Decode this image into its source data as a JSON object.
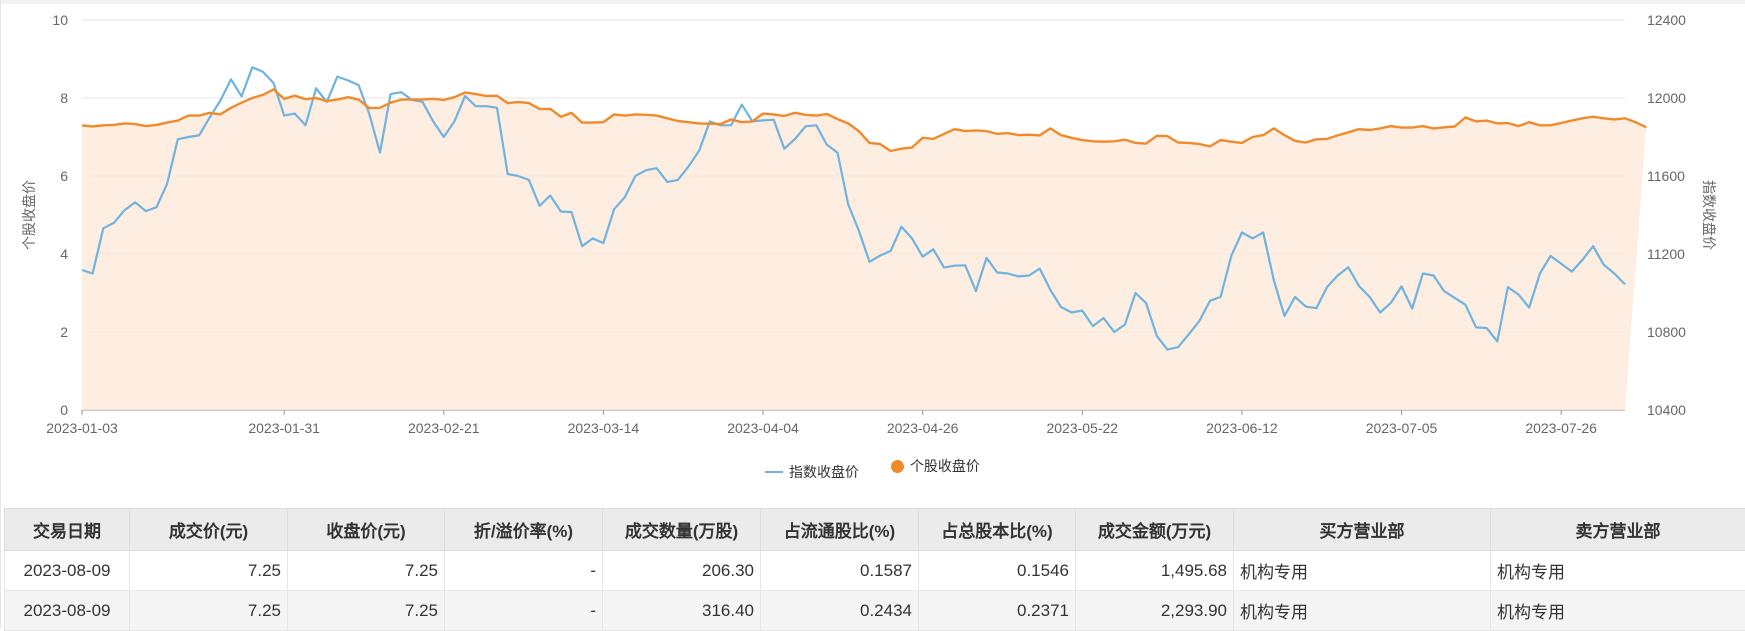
{
  "colors": {
    "index_line": "#6fb3e0",
    "stock_line": "#f08a2a",
    "stock_area": "#fde8d8",
    "grid": "#e6e6e6",
    "axis_text": "#666666"
  },
  "chart_data": {
    "type": "line",
    "y_left": {
      "label": "个股收盘价",
      "min": 0,
      "max": 10,
      "ticks": [
        0,
        2,
        4,
        6,
        8,
        10
      ]
    },
    "y_right": {
      "label": "指数收盘价",
      "min": 10400,
      "max": 12400,
      "ticks": [
        10400,
        10800,
        11200,
        11600,
        12000,
        12400
      ]
    },
    "x_ticks": [
      "2023-01-03",
      "2023-01-31",
      "2023-02-21",
      "2023-03-14",
      "2023-04-04",
      "2023-04-26",
      "2023-05-22",
      "2023-06-12",
      "2023-07-05",
      "2023-07-26"
    ],
    "x_tick_positions": [
      0,
      19,
      34,
      49,
      64,
      79,
      94,
      109,
      124,
      139
    ],
    "n_points": 146,
    "grid": true,
    "legend": "bottom-center",
    "series": [
      {
        "name": "指数收盘价",
        "axis": "right",
        "style": "line",
        "values": [
          11118,
          11100,
          11332,
          11360,
          11425,
          11465,
          11420,
          11440,
          11560,
          11788,
          11800,
          11808,
          11900,
          11986,
          12096,
          12008,
          12157,
          12135,
          12077,
          11910,
          11920,
          11860,
          12050,
          11980,
          12110,
          12090,
          12065,
          11918,
          11720,
          12020,
          12030,
          11990,
          11980,
          11880,
          11800,
          11880,
          12010,
          11958,
          11958,
          11950,
          11610,
          11600,
          11580,
          11447,
          11500,
          11418,
          11415,
          11240,
          11280,
          11256,
          11430,
          11490,
          11600,
          11630,
          11640,
          11570,
          11580,
          11650,
          11730,
          11880,
          11860,
          11860,
          11966,
          11880,
          11885,
          11888,
          11740,
          11790,
          11855,
          11860,
          11760,
          11720,
          11455,
          11320,
          11160,
          11192,
          11216,
          11340,
          11280,
          11186,
          11224,
          11130,
          11140,
          11142,
          11010,
          11180,
          11105,
          11100,
          11085,
          11090,
          11125,
          11016,
          10928,
          10900,
          10910,
          10830,
          10872,
          10800,
          10838,
          11000,
          10948,
          10780,
          10710,
          10722,
          10788,
          10856,
          10960,
          10980,
          11190,
          11310,
          11280,
          11310,
          11066,
          10882,
          10980,
          10930,
          10922,
          11030,
          11090,
          11132,
          11036,
          10980,
          10900,
          10950,
          11034,
          10920,
          11100,
          11090,
          11010,
          10975,
          10940,
          10824,
          10820,
          10752,
          11030,
          10992,
          10925,
          11100,
          11190,
          11150,
          11110,
          11170,
          11240,
          11145,
          11100,
          11044
        ]
      },
      {
        "name": "个股收盘价",
        "axis": "left",
        "style": "area",
        "values": [
          7.3,
          7.27,
          7.3,
          7.31,
          7.35,
          7.33,
          7.28,
          7.31,
          7.37,
          7.42,
          7.55,
          7.55,
          7.62,
          7.58,
          7.75,
          7.88,
          8.0,
          8.08,
          8.22,
          7.98,
          8.06,
          7.97,
          8.0,
          7.92,
          7.96,
          8.02,
          7.96,
          7.74,
          7.75,
          7.88,
          7.96,
          7.96,
          7.96,
          7.98,
          7.95,
          8.02,
          8.14,
          8.1,
          8.05,
          8.06,
          7.87,
          7.9,
          7.87,
          7.72,
          7.72,
          7.52,
          7.62,
          7.37,
          7.37,
          7.38,
          7.58,
          7.55,
          7.58,
          7.57,
          7.55,
          7.48,
          7.41,
          7.38,
          7.35,
          7.34,
          7.33,
          7.45,
          7.38,
          7.4,
          7.6,
          7.58,
          7.54,
          7.62,
          7.57,
          7.55,
          7.59,
          7.46,
          7.35,
          7.15,
          6.85,
          6.82,
          6.64,
          6.7,
          6.73,
          6.98,
          6.95,
          7.08,
          7.2,
          7.15,
          7.17,
          7.15,
          7.08,
          7.1,
          7.05,
          7.06,
          7.04,
          7.22,
          7.05,
          6.98,
          6.92,
          6.89,
          6.88,
          6.89,
          6.93,
          6.85,
          6.83,
          7.03,
          7.02,
          6.86,
          6.85,
          6.82,
          6.76,
          6.92,
          6.88,
          6.85,
          7.0,
          7.05,
          7.22,
          7.05,
          6.9,
          6.86,
          6.94,
          6.95,
          7.04,
          7.12,
          7.2,
          7.18,
          7.22,
          7.28,
          7.24,
          7.24,
          7.28,
          7.22,
          7.25,
          7.27,
          7.5,
          7.4,
          7.42,
          7.35,
          7.36,
          7.28,
          7.38,
          7.3,
          7.3,
          7.36,
          7.42,
          7.48,
          7.52,
          7.48,
          7.45,
          7.48,
          7.38,
          7.25
        ]
      }
    ]
  },
  "table": {
    "headers": [
      "交易日期",
      "成交价(元)",
      "收盘价(元)",
      "折/溢价率(%)",
      "成交数量(万股)",
      "占流通股比(%)",
      "占总股本比(%)",
      "成交金额(万元)",
      "买方营业部",
      "卖方营业部"
    ],
    "rows": [
      [
        "2023-08-09",
        "7.25",
        "7.25",
        "-",
        "206.30",
        "0.1587",
        "0.1546",
        "1,495.68",
        "机构专用",
        "机构专用"
      ],
      [
        "2023-08-09",
        "7.25",
        "7.25",
        "-",
        "316.40",
        "0.2434",
        "0.2371",
        "2,293.90",
        "机构专用",
        "机构专用"
      ]
    ]
  }
}
